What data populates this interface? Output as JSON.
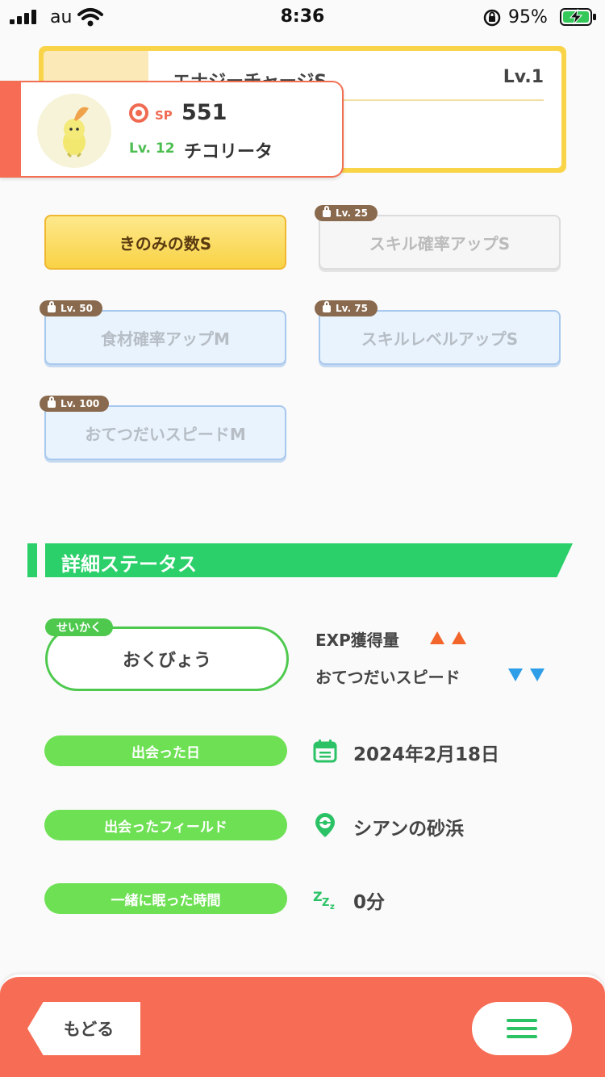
{
  "status_bar": {
    "carrier": "au",
    "time": "8:36",
    "battery": "95%"
  },
  "main_skill": {
    "name": "エナジーチャージS",
    "level": "Lv.1"
  },
  "pokemon": {
    "sp_label": "SP",
    "sp_value": "551",
    "level": "Lv. 12",
    "name": "チコリータ"
  },
  "sub_skills": [
    {
      "label": "きのみの数S",
      "state": "unlocked"
    },
    {
      "label": "スキル確率アップS",
      "lock": "Lv. 25",
      "state": "locked-gray"
    },
    {
      "label": "食材確率アップM",
      "lock": "Lv. 50",
      "state": "locked-blue"
    },
    {
      "label": "スキルレベルアップS",
      "lock": "Lv. 75",
      "state": "locked-blue"
    },
    {
      "label": "おてつだいスピードM",
      "lock": "Lv. 100",
      "state": "locked-blue"
    }
  ],
  "details": {
    "title": "詳細ステータス",
    "nature_tag": "せいかく",
    "nature": "おくびょう",
    "up_effect": "EXP獲得量",
    "down_effect": "おてつだいスピード",
    "met_date_label": "出会った日",
    "met_date": "2024年2月18日",
    "met_field_label": "出会ったフィールド",
    "met_field": "シアンの砂浜",
    "sleep_time_label": "一緒に眠った時間",
    "sleep_time": "0分",
    "sleep_icon_text": "ZZZ"
  },
  "footer": {
    "back_label": "もどる"
  },
  "colors": {
    "accent": "#f76c54",
    "green": "#2bd06a",
    "pill": "#6ee054",
    "yellow": "#f9d449"
  }
}
